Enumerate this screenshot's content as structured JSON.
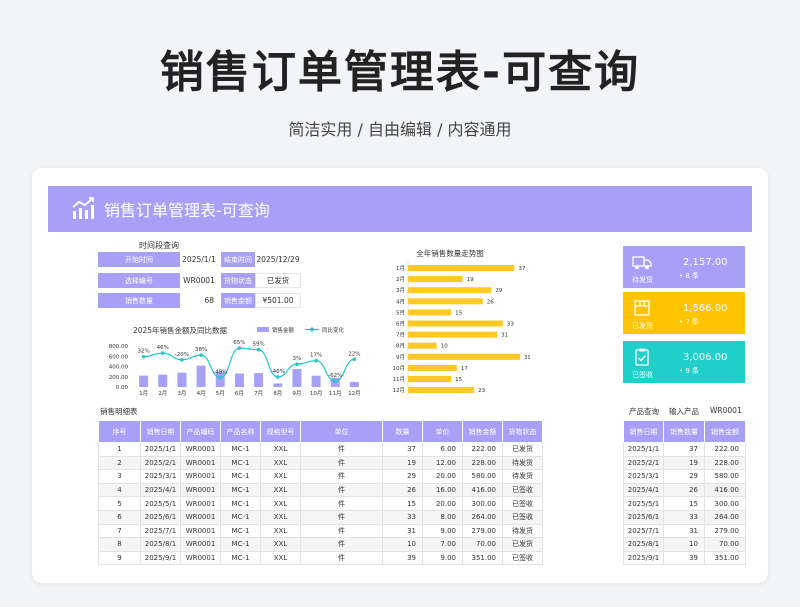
{
  "page": {
    "title": "销售订单管理表-可查询",
    "subtitle": "简洁实用 / 自由编辑 / 内容通用",
    "banner_title": "销售订单管理表-可查询"
  },
  "query": {
    "title": "时间段查询",
    "start_label": "开始时间",
    "start_value": "2025/1/1",
    "end_label": "结束时间",
    "end_value": "2025/12/29",
    "choose_label": "选择编号",
    "choose_value": "WR0001",
    "status_label": "货物状态",
    "status_value": "已发货",
    "qty_label": "销售数量",
    "qty_value": "68",
    "amount_label": "销售金额",
    "amount_value": "¥501.00"
  },
  "stats": [
    {
      "label": "待发货",
      "value": "2,157.00",
      "count": "• 8 条",
      "color": "#a6a1f7",
      "icon": "truck-icon"
    },
    {
      "label": "已发货",
      "value": "1,566.00",
      "count": "• 7 条",
      "color": "#ffc400",
      "icon": "box-icon"
    },
    {
      "label": "已签收",
      "value": "3,006.00",
      "count": "• 9 条",
      "color": "#1fcfc9",
      "icon": "clipboard-check-icon"
    }
  ],
  "colors": {
    "accent": "#a6a1f7",
    "bar_yellow": "#ffc825",
    "line_teal": "#25c6c6"
  },
  "chart_data": [
    {
      "type": "bar",
      "title": "2025年销售金额及同比数据",
      "categories": [
        "1月",
        "2月",
        "3月",
        "4月",
        "5月",
        "6月",
        "7月",
        "8月",
        "9月",
        "10月",
        "11月",
        "12月"
      ],
      "series": [
        {
          "name": "销售金额",
          "type": "bar",
          "values": [
            222,
            240,
            280,
            416,
            300,
            264,
            270,
            70,
            351,
            220,
            180,
            100
          ]
        },
        {
          "name": "同比变化",
          "type": "line",
          "values": [
            32,
            46,
            20,
            38,
            -49,
            65,
            59,
            -46,
            3,
            17,
            -62,
            22
          ],
          "labels": [
            "32%",
            "46%",
            "-20%",
            "38%",
            "-49%",
            "65%",
            "59%",
            "-46%",
            "3%",
            "17%",
            "-62%",
            "22%"
          ]
        }
      ],
      "yticks": [
        "800.00",
        "600.00",
        "400.00",
        "200.00",
        "0.00"
      ],
      "ylim": [
        0,
        800
      ]
    },
    {
      "type": "bar",
      "orientation": "horizontal",
      "title": "全年销售数量走势图",
      "categories": [
        "1月",
        "2月",
        "3月",
        "4月",
        "5月",
        "6月",
        "7月",
        "8月",
        "9月",
        "10月",
        "11月",
        "12月"
      ],
      "values": [
        37,
        19,
        29,
        26,
        15,
        33,
        31,
        10,
        39,
        17,
        15,
        23
      ]
    }
  ],
  "sections": {
    "detail_title": "销售明细表",
    "product_query_label": "产品查询",
    "input_product_label": "输入产品",
    "input_product_value": "WR0001"
  },
  "detail_table": {
    "headers": [
      "序号",
      "销售日期",
      "产品编码",
      "产品名称",
      "规格型号",
      "单位",
      "数量",
      "单价",
      "销售金额",
      "货物状态"
    ],
    "rows": [
      [
        "1",
        "2025/1/1",
        "WR0001",
        "MC-1",
        "XXL",
        "件",
        "37",
        "6.00",
        "222.00",
        "已发货"
      ],
      [
        "2",
        "2025/2/1",
        "WR0001",
        "MC-1",
        "XXL",
        "件",
        "19",
        "12.00",
        "228.00",
        "待发货"
      ],
      [
        "3",
        "2025/3/1",
        "WR0001",
        "MC-1",
        "XXL",
        "件",
        "29",
        "20.00",
        "580.00",
        "待发货"
      ],
      [
        "4",
        "2025/4/1",
        "WR0001",
        "MC-1",
        "XXL",
        "件",
        "26",
        "16.00",
        "416.00",
        "已签收"
      ],
      [
        "5",
        "2025/5/1",
        "WR0001",
        "MC-1",
        "XXL",
        "件",
        "15",
        "20.00",
        "300.00",
        "已签收"
      ],
      [
        "6",
        "2025/6/1",
        "WR0001",
        "MC-1",
        "XXL",
        "件",
        "33",
        "8.00",
        "264.00",
        "已签收"
      ],
      [
        "7",
        "2025/7/1",
        "WR0001",
        "MC-1",
        "XXL",
        "件",
        "31",
        "9.00",
        "279.00",
        "待发货"
      ],
      [
        "8",
        "2025/8/1",
        "WR0001",
        "MC-1",
        "XXL",
        "件",
        "10",
        "7.00",
        "70.00",
        "已发货"
      ],
      [
        "9",
        "2025/9/1",
        "WR0001",
        "MC-1",
        "XXL",
        "件",
        "39",
        "9.00",
        "351.00",
        "已签收"
      ]
    ]
  },
  "result_table": {
    "headers": [
      "销售日期",
      "销售数量",
      "销售金额"
    ],
    "rows": [
      [
        "2025/1/1",
        "37",
        "222.00"
      ],
      [
        "2025/2/1",
        "19",
        "228.00"
      ],
      [
        "2025/3/1",
        "29",
        "580.00"
      ],
      [
        "2025/4/1",
        "26",
        "416.00"
      ],
      [
        "2025/5/1",
        "15",
        "300.00"
      ],
      [
        "2025/6/1",
        "33",
        "264.00"
      ],
      [
        "2025/7/1",
        "31",
        "279.00"
      ],
      [
        "2025/8/1",
        "10",
        "70.00"
      ],
      [
        "2025/9/1",
        "39",
        "351.00"
      ]
    ]
  }
}
